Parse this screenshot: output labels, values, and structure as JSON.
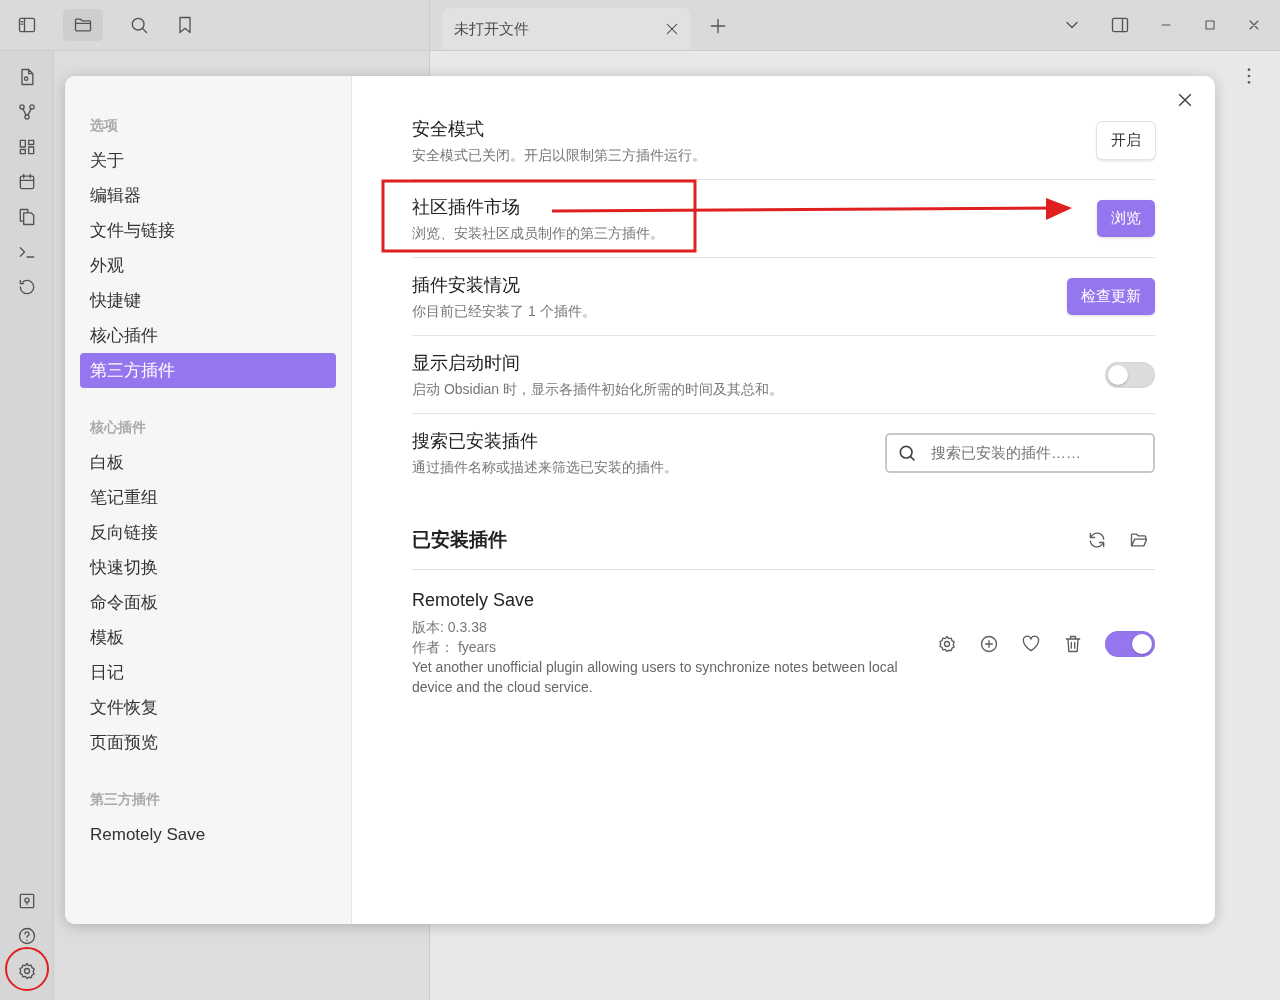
{
  "tabs": [
    {
      "label": "未打开文件",
      "selected": true
    }
  ],
  "settings_dialog": {
    "nav_groups": [
      {
        "heading": "选项",
        "items": [
          {
            "label": "关于",
            "selected": false
          },
          {
            "label": "编辑器",
            "selected": false
          },
          {
            "label": "文件与链接",
            "selected": false
          },
          {
            "label": "外观",
            "selected": false
          },
          {
            "label": "快捷键",
            "selected": false
          },
          {
            "label": "核心插件",
            "selected": false
          },
          {
            "label": "第三方插件",
            "selected": true
          }
        ]
      },
      {
        "heading": "核心插件",
        "items": [
          {
            "label": "白板",
            "selected": false
          },
          {
            "label": "笔记重组",
            "selected": false
          },
          {
            "label": "反向链接",
            "selected": false
          },
          {
            "label": "快速切换",
            "selected": false
          },
          {
            "label": "命令面板",
            "selected": false
          },
          {
            "label": "模板",
            "selected": false
          },
          {
            "label": "日记",
            "selected": false
          },
          {
            "label": "文件恢复",
            "selected": false
          },
          {
            "label": "页面预览",
            "selected": false
          }
        ]
      },
      {
        "heading": "第三方插件",
        "items": [
          {
            "label": "Remotely Save",
            "selected": false
          }
        ]
      }
    ],
    "settings": [
      {
        "kind": "button",
        "name": "安全模式",
        "description": "安全模式已关闭。开启以限制第三方插件运行。",
        "button": "开启",
        "primary": false
      },
      {
        "kind": "button",
        "name": "社区插件市场",
        "description": "浏览、安装社区成员制作的第三方插件。",
        "button": "浏览",
        "primary": true
      },
      {
        "kind": "button",
        "name": "插件安装情况",
        "description": "你目前已经安装了 1 个插件。",
        "button": "检查更新",
        "primary": true
      },
      {
        "kind": "toggle",
        "name": "显示启动时间",
        "description": "启动 Obsidian 时，显示各插件初始化所需的时间及其总和。",
        "on": false
      },
      {
        "kind": "search",
        "name": "搜索已安装插件",
        "description": "通过插件名称或描述来筛选已安装的插件。",
        "placeholder": "搜索已安装的插件……"
      }
    ],
    "installed": {
      "heading": "已安装插件",
      "plugins": [
        {
          "name": "Remotely Save",
          "version": "版本: 0.3.38",
          "author": "作者： fyears",
          "description": "Yet another unofficial plugin allowing users to synchronize notes between local device and the cloud service.",
          "enabled": true
        }
      ]
    }
  }
}
